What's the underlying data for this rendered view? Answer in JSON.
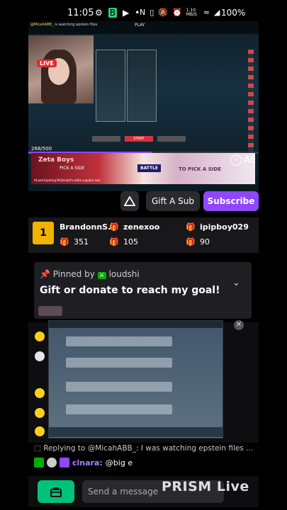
{
  "status_bar": {
    "time": "11:05",
    "network_speed": "1.10 MB/S",
    "battery": "100%"
  },
  "video": {
    "top_chat_user": "@MicahABB_",
    "top_chat_text": "is watching epstein files",
    "live_badge": "LIVE",
    "view_progress": "268/500",
    "game_title": "PLAY",
    "game_button": "START",
    "progress_fraction": 0.536
  },
  "ad": {
    "brand": "Zeta Boys",
    "promo": "PICK A SIDE",
    "battle": "BATTLE",
    "tagline": "TO PICK A SIDE",
    "fine_print": "At participating McDonald's while supplies last.",
    "label": "Ad"
  },
  "actions": {
    "gift_label": "Gift A Sub",
    "subscribe_label": "Subscribe"
  },
  "leaderboard": [
    {
      "name": "BrandonnS..",
      "value": "351"
    },
    {
      "name": "zenexoo",
      "value": "105"
    },
    {
      "name": "ipipboy029",
      "value": "90"
    }
  ],
  "pinned": {
    "label_prefix": "Pinned by",
    "pinned_by": "loudshi",
    "message": "Gift or donate to reach my goal!"
  },
  "chat": {
    "replying_text": "Replying to @MicahABB_: I was watching epstein files ...",
    "username": "clnara:",
    "message": "@big e",
    "input_placeholder": "Send a message"
  },
  "watermark": "PRISM Live",
  "colors": {
    "accent_purple": "#9146ff",
    "shop_green": "#00c27a",
    "live_red": "#e52b2b"
  }
}
